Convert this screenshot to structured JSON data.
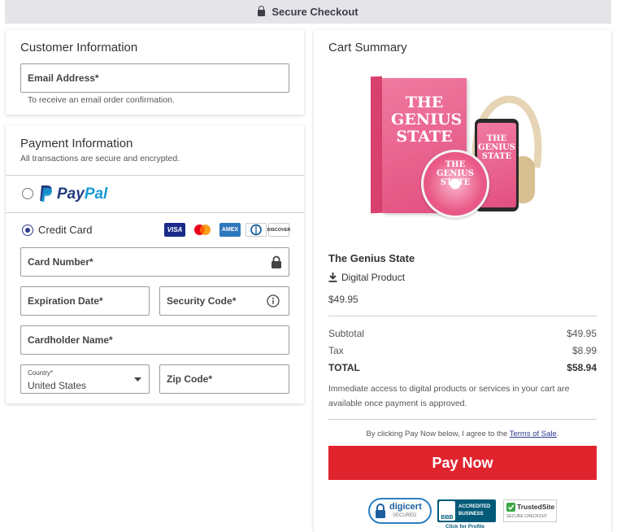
{
  "header": {
    "title": "Secure Checkout"
  },
  "customer": {
    "title": "Customer Information",
    "email_label": "Email Address*",
    "email_hint": "To receive an email order confirmation."
  },
  "payment": {
    "title": "Payment Information",
    "subtitle": "All transactions are secure and encrypted.",
    "paypal_label_pay": "Pay",
    "paypal_label_pal": "Pal",
    "credit_card_label": "Credit Card",
    "card_brands": [
      "VISA",
      "Mastercard",
      "AMEX",
      "Diners",
      "DISCOVER"
    ],
    "card_number_label": "Card Number*",
    "expiration_label": "Expiration Date*",
    "security_code_label": "Security Code*",
    "cardholder_label": "Cardholder Name*",
    "country_label": "Country*",
    "country_value": "United States",
    "zip_label": "Zip Code*",
    "selected_method": "Credit Card"
  },
  "cart": {
    "title": "Cart Summary",
    "product_cover_text": "THE GENIUS STATE",
    "product_name": "The Genius State",
    "product_type": "Digital Product",
    "product_price": "$49.95",
    "subtotal_label": "Subtotal",
    "subtotal_value": "$49.95",
    "tax_label": "Tax",
    "tax_value": "$8.99",
    "total_label": "TOTAL",
    "total_value": "$58.94",
    "access_note": "Immediate access to digital products or services in your cart are available once payment is approved.",
    "terms_prefix": "By clicking Pay Now below, I agree to the ",
    "terms_link": "Terms of Sale",
    "terms_suffix": ".",
    "pay_button": "Pay Now"
  },
  "badges": {
    "digicert": "digicert",
    "digicert_sub": "SECURED",
    "bbb_line1": "ACCREDITED",
    "bbb_line2": "BUSINESS",
    "bbb_sub": "Click for Profile",
    "bbb_mark": "BBB",
    "trusted": "TrustedSite",
    "trusted_sub": "SECURE CHECKOUT"
  },
  "colors": {
    "accent": "#2e3a8c",
    "pay_button": "#e0242e",
    "paypal_dark": "#253b80",
    "paypal_light": "#179bd7"
  }
}
